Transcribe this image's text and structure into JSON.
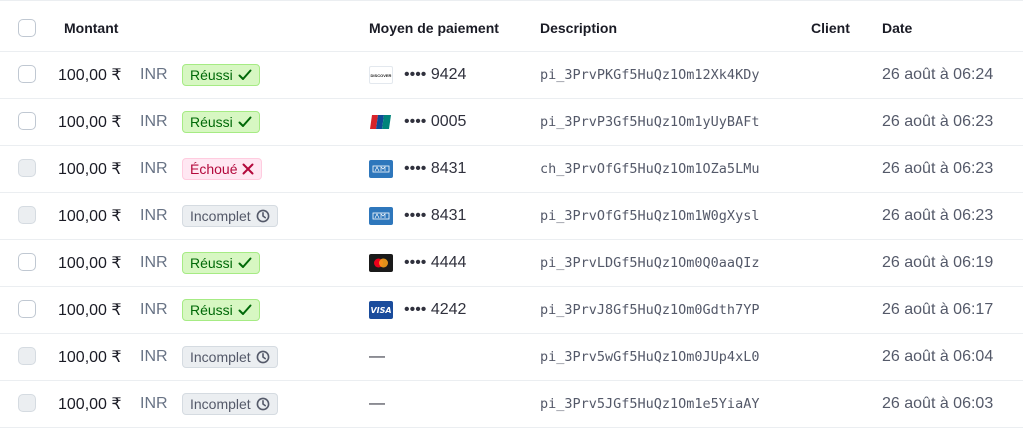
{
  "columns": {
    "amount": "Montant",
    "payment_method": "Moyen de paiement",
    "description": "Description",
    "customer": "Client",
    "date": "Date"
  },
  "rows": [
    {
      "amount": "100,00 ₹",
      "currency": "INR",
      "status": "Réussi",
      "status_type": "succeeded",
      "card_brand": "discover",
      "last4": "•••• 9424",
      "description": "pi_3PrvPKGf5HuQz1Om12Xk4KDy",
      "date": "26 août à 06:24",
      "checkbox_enabled": true
    },
    {
      "amount": "100,00 ₹",
      "currency": "INR",
      "status": "Réussi",
      "status_type": "succeeded",
      "card_brand": "unionpay",
      "last4": "•••• 0005",
      "description": "pi_3PrvP3Gf5HuQz1Om1yUyBAFt",
      "date": "26 août à 06:23",
      "checkbox_enabled": true
    },
    {
      "amount": "100,00 ₹",
      "currency": "INR",
      "status": "Échoué",
      "status_type": "failed",
      "card_brand": "amex",
      "last4": "•••• 8431",
      "description": "ch_3PrvOfGf5HuQz1Om1OZa5LMu",
      "date": "26 août à 06:23",
      "checkbox_enabled": false
    },
    {
      "amount": "100,00 ₹",
      "currency": "INR",
      "status": "Incomplet",
      "status_type": "incomplete",
      "card_brand": "amex",
      "last4": "•••• 8431",
      "description": "pi_3PrvOfGf5HuQz1Om1W0gXysl",
      "date": "26 août à 06:23",
      "checkbox_enabled": false
    },
    {
      "amount": "100,00 ₹",
      "currency": "INR",
      "status": "Réussi",
      "status_type": "succeeded",
      "card_brand": "mastercard",
      "last4": "•••• 4444",
      "description": "pi_3PrvLDGf5HuQz1Om0Q0aaQIz",
      "date": "26 août à 06:19",
      "checkbox_enabled": true
    },
    {
      "amount": "100,00 ₹",
      "currency": "INR",
      "status": "Réussi",
      "status_type": "succeeded",
      "card_brand": "visa",
      "last4": "•••• 4242",
      "description": "pi_3PrvJ8Gf5HuQz1Om0Gdth7YP",
      "date": "26 août à 06:17",
      "checkbox_enabled": true
    },
    {
      "amount": "100,00 ₹",
      "currency": "INR",
      "status": "Incomplet",
      "status_type": "incomplete",
      "card_brand": "",
      "last4": "—",
      "description": "pi_3Prv5wGf5HuQz1Om0JUp4xL0",
      "date": "26 août à 06:04",
      "checkbox_enabled": false
    },
    {
      "amount": "100,00 ₹",
      "currency": "INR",
      "status": "Incomplet",
      "status_type": "incomplete",
      "card_brand": "",
      "last4": "—",
      "description": "pi_3Prv5JGf5HuQz1Om1e5YiaAY",
      "date": "26 août à 06:03",
      "checkbox_enabled": false
    }
  ],
  "card_logo_text": {
    "discover": "DISCOVER",
    "visa": "VISA"
  },
  "colors": {
    "succeeded_bg": "#d7f7c2",
    "succeeded_text": "#006908",
    "failed_bg": "#ffe7f2",
    "failed_text": "#b3093c",
    "incomplete_bg": "#ebeef1",
    "incomplete_text": "#545969"
  }
}
